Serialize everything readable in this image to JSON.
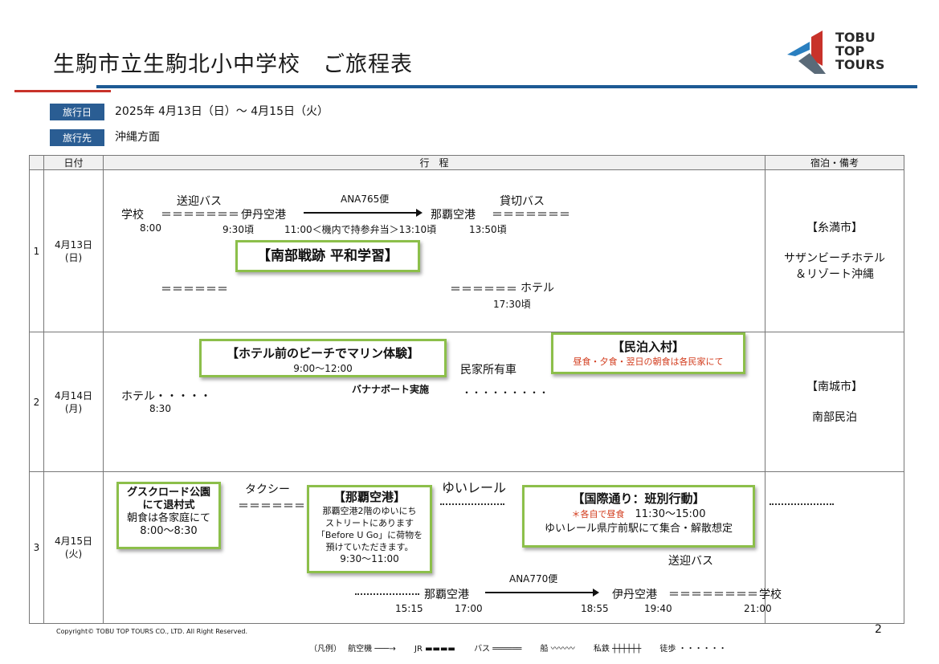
{
  "title": "生駒市立生駒北小中学校　ご旅程表",
  "logo": {
    "line1": "TOBU",
    "line2": "TOP",
    "line3": "TOURS",
    "colors": [
      "#2a7fc0",
      "#c8322a",
      "#5a5a5a"
    ]
  },
  "info": {
    "date_tag": "旅行日",
    "date_value": "2025年 4月13日（日）～ 4月15日（火）",
    "dest_tag": "旅行先",
    "dest_value": "沖縄方面"
  },
  "headers": {
    "date": "日付",
    "itinerary": "行　程",
    "stay": "宿泊・備考"
  },
  "rows": [
    {
      "no": "1",
      "date": "4月13日",
      "dow": "(日)",
      "stay_city": "【糸満市】",
      "stay_name1": "サザンビーチホテル",
      "stay_name2": "＆リゾート沖縄"
    },
    {
      "no": "2",
      "date": "4月14日",
      "dow": "(月)",
      "stay_city": "【南城市】",
      "stay_name1": "南部民泊"
    },
    {
      "no": "3",
      "date": "4月15日",
      "dow": "(火)"
    }
  ],
  "day1": {
    "school": "学校",
    "school_time": "8:00",
    "bus_label": "送迎バス",
    "bus_line": "＝＝＝＝＝＝＝",
    "itami": "伊丹空港",
    "itami_time": "9:30頃",
    "flight": "ANA765便",
    "flight_note": "11:00＜機内で持参弁当＞13:10頃",
    "naha": "那覇空港",
    "charter": "貸切バス",
    "charter_line": "＝＝＝＝＝＝＝",
    "charter_time": "13:50頃",
    "study": "【南部戦跡 平和学習】",
    "line_a": "＝＝＝＝＝＝",
    "line_b": "＝＝＝＝＝＝",
    "hotel": "ホテル",
    "hotel_time": "17:30頃"
  },
  "day2": {
    "hotel": "ホテル・・・・・",
    "hotel_time": "8:30",
    "marine": "【ホテル前のビーチでマリン体験】",
    "marine_time": "9:00～12:00",
    "banana": "バナナボート実施",
    "car": "民家所有車",
    "dots": "・・・・・・・・・",
    "minpaku": "【民泊入村】",
    "minpaku_note": "昼食・夕食・翌日の朝食は各民家にて"
  },
  "day3": {
    "gusuku1": "グスクロード公園",
    "gusuku2": "にて退村式",
    "gusuku3": "朝食は各家庭にて",
    "gusuku_time": "8:00～8:30",
    "taxi": "タクシー",
    "taxi_line": "＝＝＝＝＝＝",
    "airport_title": "【那覇空港】",
    "airport1": "那覇空港2階のゆいにち",
    "airport2": "ストリートにあります",
    "airport3": "「Before U Go」に荷物を",
    "airport4": "預けていただきます。",
    "airport_time": "9:30～11:00",
    "yui": "ゆいレール",
    "kokusai": "【国際通り：班別行動】",
    "kokusai_note": "＊各自で昼食",
    "kokusai_time": "11:30～15:00",
    "kokusai_meet": "ゆいレール県庁前駅にて集合・解散想定",
    "bus": "送迎バス",
    "naha": "那覇空港",
    "flight": "ANA770便",
    "itami": "伊丹空港",
    "line": "＝＝＝＝＝＝＝＝",
    "school": "学校",
    "t1": "15:15",
    "t2": "17:00",
    "t3": "18:55",
    "t4": "19:40",
    "t5": "21:00"
  },
  "footer": {
    "copyright": "Copyright© TOBU TOP TOURS CO., LTD. All Right Reserved.",
    "page": "2"
  },
  "legend": {
    "label": "（凡例）",
    "air": "航空機",
    "jr": "JR",
    "bus": "バス",
    "ship": "船",
    "private": "私鉄",
    "walk": "徒歩"
  }
}
